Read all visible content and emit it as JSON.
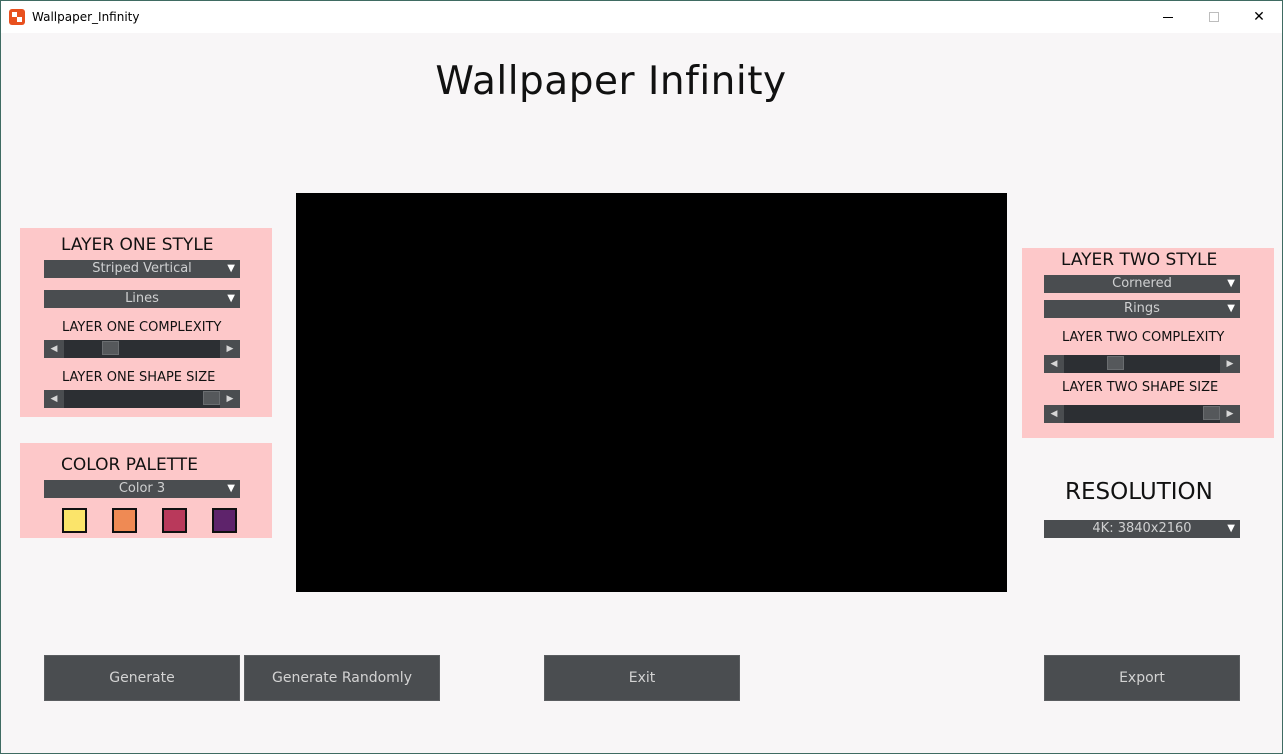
{
  "window": {
    "title": "Wallpaper_Infinity",
    "controls": {
      "minimize": "—",
      "maximize": "☐",
      "close": "✕"
    }
  },
  "app_title": "Wallpaper  Infinity",
  "layer_one": {
    "heading": "LAYER ONE STYLE",
    "style_value": "Striped Vertical",
    "shape_value": "Lines",
    "complexity_label": "LAYER ONE COMPLEXITY",
    "complexity_level": 0.27,
    "shape_size_label": "LAYER ONE SHAPE SIZE",
    "shape_size_level": 1.0
  },
  "color_palette": {
    "heading": "COLOR PALETTE",
    "value": "Color 3",
    "swatches": [
      "#fbe46a",
      "#ef8a54",
      "#b9395b",
      "#5e236b"
    ]
  },
  "layer_two": {
    "heading": "LAYER TWO STYLE",
    "style_value": "Cornered",
    "shape_value": "Rings",
    "complexity_label": "LAYER TWO COMPLEXITY",
    "complexity_level": 0.31,
    "shape_size_label": "LAYER TWO SHAPE SIZE",
    "shape_size_level": 1.0
  },
  "resolution": {
    "heading": "RESOLUTION",
    "value": "4K: 3840x2160"
  },
  "buttons": {
    "generate": "Generate",
    "generate_randomly": "Generate Randomly",
    "exit": "Exit",
    "export": "Export"
  },
  "icons": {
    "dropdown_arrow": "▼",
    "slider_left": "◀",
    "slider_right": "▶"
  },
  "colors": {
    "panel_bg": "#fdc8c9",
    "control_bg": "#4a4d50",
    "track_bg": "#2c2f33",
    "preview_bg": "#000000",
    "app_bg": "#f8f6f7"
  }
}
